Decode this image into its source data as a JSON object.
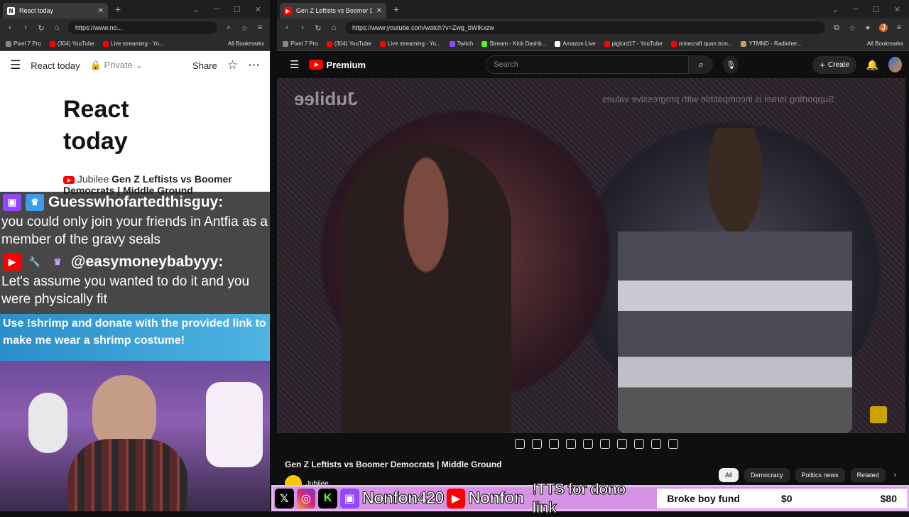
{
  "left_browser": {
    "tab_title": "React today",
    "url": "https://www.no...",
    "bookmarks": [
      "Pixel 7 Pro",
      "(304) YouTube",
      "Live streaming - Yo..."
    ],
    "all_bookmarks": "All Bookmarks",
    "doc": {
      "header_title": "React today",
      "privacy": "Private",
      "share": "Share",
      "title": "React today",
      "line1_channel": "Jubilee",
      "line1_text": "Gen Z Leftists vs Boomer Democrats | Middle Ground"
    }
  },
  "chat": {
    "message1": {
      "user": "Guesswhofartedthisguy:",
      "text": "you could only join your friends in Antfia as a member of the gravy seals"
    },
    "message2": {
      "user": "@easymoneybabyyy:",
      "text": "Let's assume you wanted to do it and you were physically fit"
    }
  },
  "shrimp_banner": "Use !shrimp and donate with the provided link to make me wear a shrimp costume!",
  "right_browser": {
    "tab_title": "Gen Z Leftists vs Boomer Demo",
    "url": "https://www.youtube.com/watch?v=Zwg_bWlKxzw",
    "bookmarks": [
      "Pixel 7 Pro",
      "(304) YouTube",
      "Live streaming - Yo...",
      "Twitch",
      "Stream - Kick Dashb...",
      "Amazon Live",
      "piglord17 - YouTube",
      "minecraft quan tron...",
      "YTMND - Radioher..."
    ],
    "all_bookmarks": "All Bookmarks",
    "yt": {
      "brand": "Premium",
      "search_placeholder": "Search",
      "create": "Create"
    },
    "video": {
      "brand_overlay": "Jubilee",
      "caption_overlay": "Supporting Israel is incompatible with progressive values",
      "title": "Gen Z Leftists vs Boomer Democrats | Middle Ground",
      "channel": "Jubilee",
      "chips": [
        "All",
        "Democracy",
        "Politics news",
        "Related"
      ]
    }
  },
  "stream_bar": {
    "handle1": "Nonfon420",
    "handle2": "Nonfon",
    "tts": "!TTS for dono link",
    "fund_label": "Broke boy fund",
    "fund_current": "$0",
    "fund_goal": "$80"
  },
  "colors": {
    "youtube_red": "#ff0000",
    "twitch_purple": "#9146ff",
    "kick_green": "#53fc18",
    "bar_pink": "#d693e3"
  }
}
